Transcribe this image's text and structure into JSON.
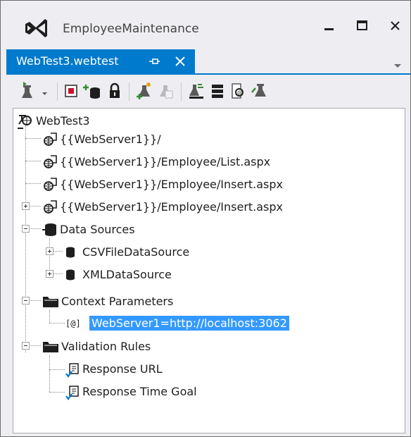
{
  "window": {
    "title": "EmployeeMaintenance",
    "logo_icon": "visual-studio-icon"
  },
  "tabs": [
    {
      "label": "WebTest3.webtest",
      "active": true,
      "pinned": true
    }
  ],
  "toolbar": {
    "buttons": [
      "run-test-icon",
      "dropdown-icon",
      "record-icon",
      "add-data-source-icon",
      "lock-icon",
      "add-request-plugin-icon",
      "add-transaction-icon",
      "parameterize-icon",
      "set-credentials-icon",
      "generate-code-icon",
      "performance-session-icon"
    ]
  },
  "tree": {
    "root": {
      "label": "WebTest3"
    },
    "requests": [
      {
        "label": "{{WebServer1}}/"
      },
      {
        "label": "{{WebServer1}}/Employee/List.aspx"
      },
      {
        "label": "{{WebServer1}}/Employee/Insert.aspx"
      },
      {
        "label": "{{WebServer1}}/Employee/Insert.aspx"
      }
    ],
    "data_sources": {
      "label": "Data Sources",
      "items": [
        {
          "label": "CSVFileDataSource"
        },
        {
          "label": "XMLDataSource"
        }
      ]
    },
    "context_parameters": {
      "label": "Context Parameters",
      "items": [
        {
          "label": "WebServer1=http://localhost:3062",
          "selected": true
        }
      ]
    },
    "validation_rules": {
      "label": "Validation Rules",
      "items": [
        {
          "label": "Response URL"
        },
        {
          "label": "Response Time Goal"
        }
      ]
    }
  },
  "colors": {
    "accent": "#007acc",
    "selection": "#3399ff",
    "chrome": "#eeeef2",
    "record": "#c8102e"
  }
}
